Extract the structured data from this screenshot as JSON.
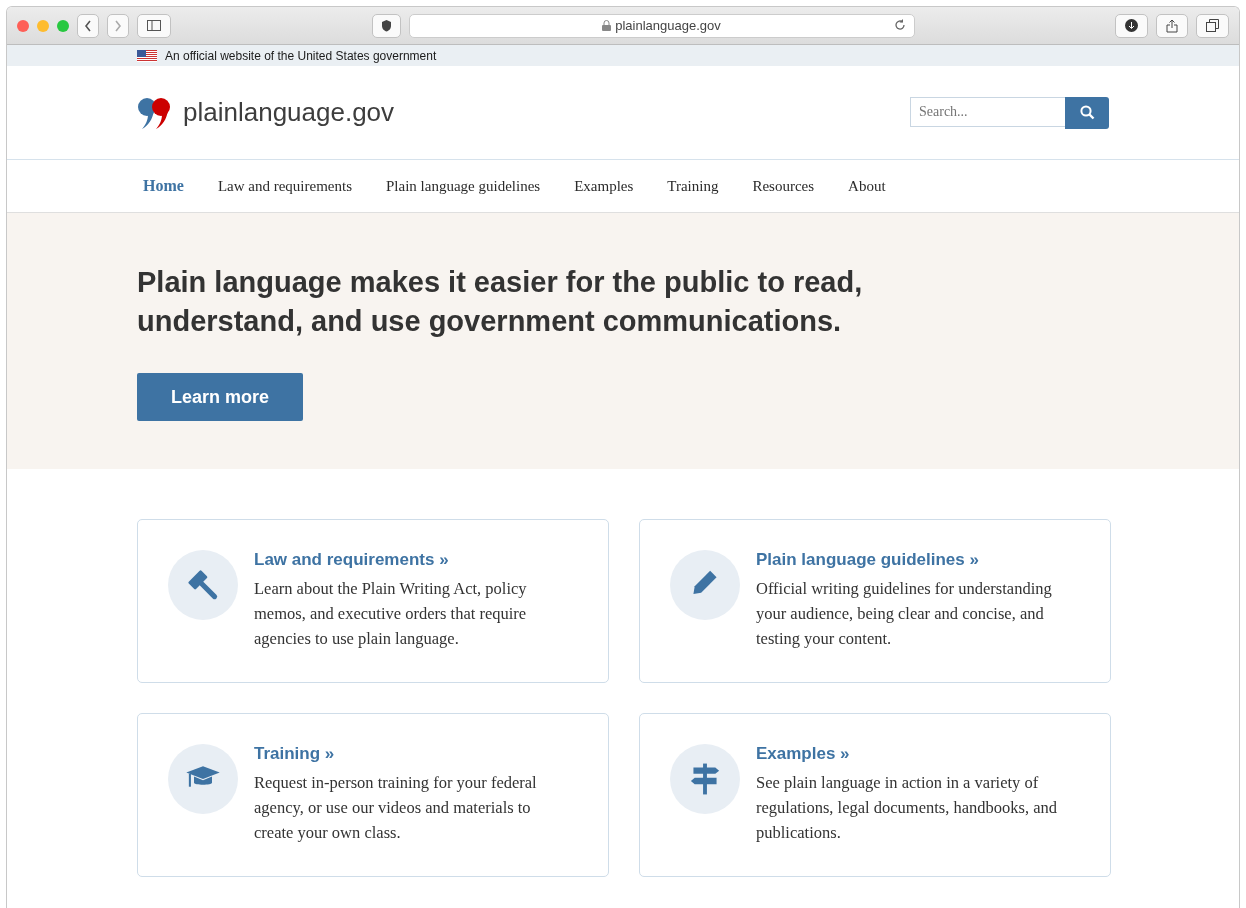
{
  "browser": {
    "address": "plainlanguage.gov"
  },
  "banner": {
    "text": "An official website of the United States government"
  },
  "header": {
    "site_name": "plainlanguage.gov",
    "search": {
      "placeholder": "Search..."
    }
  },
  "nav": [
    {
      "label": "Home",
      "selected": true
    },
    {
      "label": "Law and requirements",
      "selected": false
    },
    {
      "label": "Plain language guidelines",
      "selected": false
    },
    {
      "label": "Examples",
      "selected": false
    },
    {
      "label": "Training",
      "selected": false
    },
    {
      "label": "Resources",
      "selected": false
    },
    {
      "label": "About",
      "selected": false
    }
  ],
  "hero": {
    "headline": "Plain language makes it easier for the public to read, understand, and use government communications.",
    "button": "Learn more"
  },
  "cards": [
    {
      "title": "Law and requirements »",
      "text": "Learn about the Plain Writing Act, policy memos, and executive orders that require agencies to use plain language."
    },
    {
      "title": "Plain language guidelines »",
      "text": "Official writing guidelines for understanding your audience, being clear and concise, and testing your content."
    },
    {
      "title": "Training »",
      "text": "Request in-person training for your federal agency, or use our videos and materials to create your own class."
    },
    {
      "title": "Examples »",
      "text": "See plain language in action in a variety of regulations, legal documents, handbooks, and publications."
    }
  ]
}
